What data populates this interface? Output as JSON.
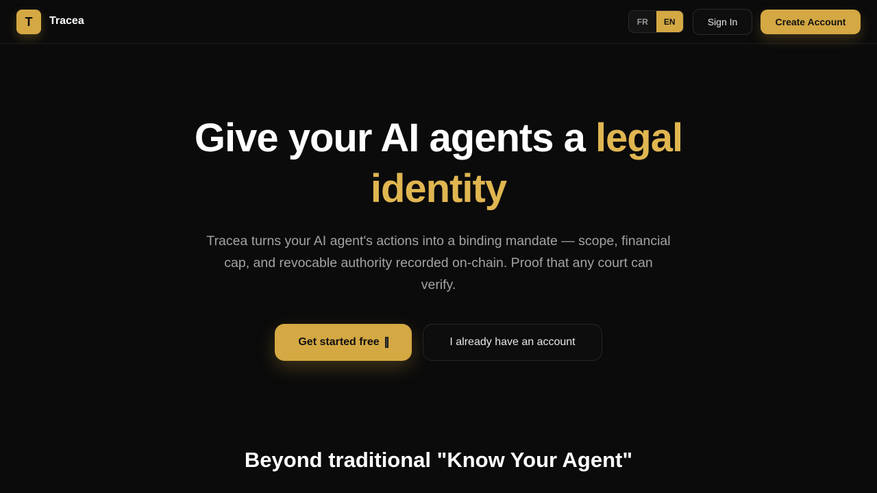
{
  "header": {
    "logo_letter": "T",
    "brand": "Tracea",
    "languages": [
      "FR",
      "EN"
    ],
    "active_language": "EN",
    "sign_in": "Sign In",
    "create_account": "Create Account"
  },
  "hero": {
    "title_part1": "Give your AI agents a ",
    "title_highlight": "legal identity",
    "subtitle": "Tracea turns your AI agent's actions into a binding mandate — scope, financial cap, and revocable authority recorded on-chain. Proof that any court can verify.",
    "cta_primary": "Get started free",
    "cta_secondary": "I already have an account"
  },
  "section": {
    "title": "Beyond traditional \"Know Your Agent\""
  },
  "colors": {
    "accent": "#d4a843",
    "background": "#0b0b0b"
  }
}
